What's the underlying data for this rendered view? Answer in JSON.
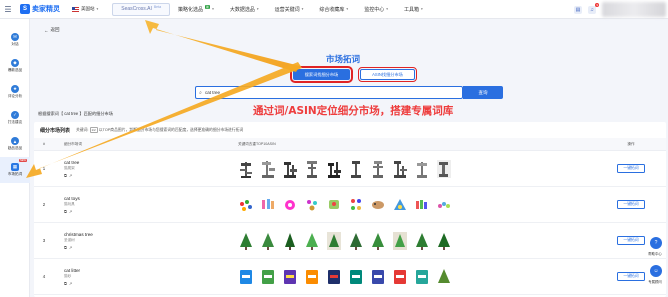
{
  "header": {
    "logo_text": "卖家精灵",
    "region": "美国站",
    "nav": [
      {
        "label": "SeasCross.AI",
        "badge": "Beta",
        "active": true
      },
      {
        "label": "策略化选品",
        "badge": "新"
      },
      {
        "label": "大数据选品"
      },
      {
        "label": "运营关键词"
      },
      {
        "label": "综合收藏库"
      },
      {
        "label": "监控中心"
      },
      {
        "label": "工具箱"
      }
    ],
    "notif_count": "9"
  },
  "sidebar": {
    "items": [
      {
        "label": "对话",
        "icon": "chat-icon"
      },
      {
        "label": "爆款选品",
        "icon": "product-icon"
      },
      {
        "label": "评论分析",
        "icon": "review-icon"
      },
      {
        "label": "打法建议",
        "icon": "strategy-icon"
      },
      {
        "label": "趋品选品",
        "icon": "trend-icon"
      },
      {
        "label": "市场拓词",
        "icon": "market-icon",
        "active": true,
        "badge": "NEW"
      }
    ]
  },
  "main": {
    "back_label": "返回",
    "title": "市场拓词",
    "mode_buttons": [
      "搜索词找细分市场",
      "ASIN找细分市场"
    ],
    "search_value": "cat tree",
    "search_button": "查询",
    "overlay_text": "通过词/ASIN定位细分市场，搭建专属词库",
    "result_text": "根据搜索词【 cat tree 】匹配的细分市场",
    "panel_title": "细分市场列表",
    "panel_hint_prefix": "关键词:",
    "panel_hint_key": "1/2",
    "panel_hint_text": "以TOP商品图片，判断细分市场与您搜索词的匹配度，选择更准确的细分市场进行拓词",
    "table_headers": [
      "#",
      "细分市场词",
      "关键词去重TOP10ASIN",
      "操作"
    ],
    "rows": [
      {
        "idx": "1",
        "keyword": "cat tree",
        "cn": "猫爬架"
      },
      {
        "idx": "2",
        "keyword": "cat toys",
        "cn": "猫玩具"
      },
      {
        "idx": "3",
        "keyword": "christmas tree",
        "cn": "圣诞树"
      },
      {
        "idx": "4",
        "keyword": "cat litter",
        "cn": "猫砂"
      }
    ],
    "row_action": "一键拓词"
  },
  "floating": {
    "help_label": "帮助中心",
    "advisor_label": "专属顾问"
  },
  "colors": {
    "primary": "#2a6fe0",
    "overlay_red": "#ee3d3d"
  }
}
